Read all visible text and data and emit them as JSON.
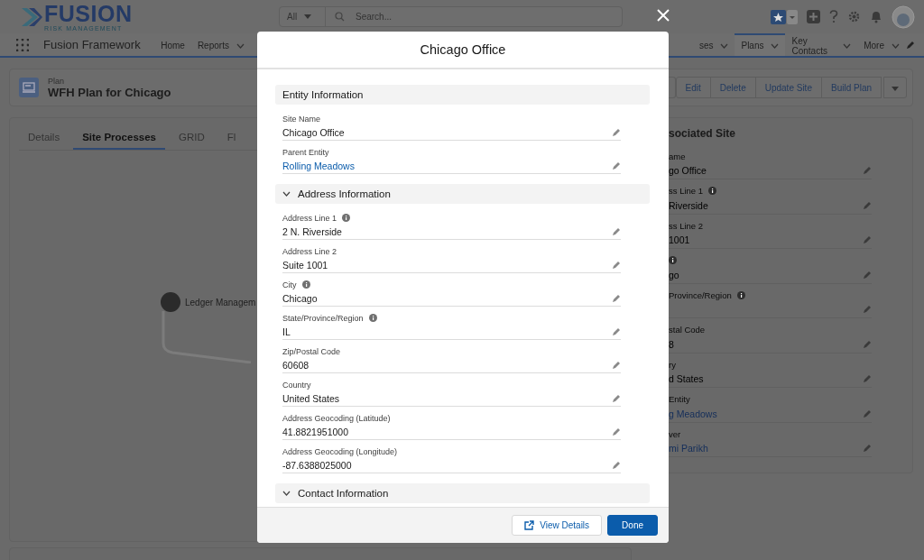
{
  "header": {
    "logo": {
      "name": "FUSION",
      "tagline": "RISK MANAGEMENT"
    },
    "search": {
      "scope": "All",
      "placeholder": "Search..."
    }
  },
  "nav": {
    "app_name": "Fusion Framework",
    "items_left": [
      {
        "label": "Home",
        "dropdown": false,
        "selected": false
      },
      {
        "label": "Reports",
        "dropdown": true,
        "selected": false
      }
    ],
    "items_right": [
      {
        "label": "ses",
        "dropdown": true,
        "selected": false
      },
      {
        "label": "Plans",
        "dropdown": true,
        "selected": true
      },
      {
        "label": "Key Contacts",
        "dropdown": true,
        "selected": false
      },
      {
        "label": "More",
        "dropdown": true,
        "selected": false
      }
    ]
  },
  "record": {
    "type": "Plan",
    "title": "WFH Plan for Chicago",
    "actions": [
      "Edit",
      "Delete",
      "Update Site",
      "Build Plan"
    ]
  },
  "tabs": [
    {
      "label": "Details",
      "selected": false
    },
    {
      "label": "Site Processes",
      "selected": true
    },
    {
      "label": "GRID",
      "selected": false
    },
    {
      "label": "Fl",
      "selected": false
    }
  ],
  "diagram": {
    "nodes": [
      {
        "label": "Ledger Managem"
      }
    ]
  },
  "side_panel": {
    "title": "sociated Site",
    "fields": [
      {
        "label": "ame",
        "value": "go Office",
        "info": false,
        "link": false
      },
      {
        "label": "ss Line 1",
        "value": "Riverside",
        "info": true,
        "link": false
      },
      {
        "label": "ss Line 2",
        "value": "1001",
        "info": false,
        "link": false
      },
      {
        "value": "go",
        "info": true,
        "link": false
      },
      {
        "label": "Province/Region",
        "info": true,
        "link": false
      },
      {
        "label": "stal Code",
        "value": "8",
        "info": false,
        "link": false
      },
      {
        "label": "ry",
        "value": "d States",
        "info": false,
        "link": false
      },
      {
        "label": "Entity",
        "value": "g Meadows",
        "info": false,
        "link": true
      },
      {
        "label": "ver",
        "value": "mi Parikh",
        "info": false,
        "link": true
      }
    ]
  },
  "modal": {
    "title": "Chicago Office",
    "sections": [
      {
        "title": "Entity Information",
        "kind": "plain",
        "fields": [
          {
            "label": "Site Name",
            "value": "Chicago Office",
            "info": false,
            "link": false
          },
          {
            "label": "Parent Entity",
            "value": "Rolling Meadows",
            "info": false,
            "link": true
          }
        ]
      },
      {
        "title": "Address Information",
        "kind": "collapsible",
        "expanded": true,
        "fields": [
          {
            "label": "Address Line 1",
            "value": "2 N. Riverside",
            "info": true,
            "link": false
          },
          {
            "label": "Address Line 2",
            "value": "Suite 1001",
            "info": false,
            "link": false
          },
          {
            "label": "City",
            "value": "Chicago",
            "info": true,
            "link": false
          },
          {
            "label": "State/Province/Region",
            "value": "IL",
            "info": true,
            "link": false
          },
          {
            "label": "Zip/Postal Code",
            "value": "60608",
            "info": false,
            "link": false
          },
          {
            "label": "Country",
            "value": "United States",
            "info": false,
            "link": false
          },
          {
            "label": "Address Geocoding (Latitude)",
            "value": "41.8821951000",
            "info": false,
            "link": false
          },
          {
            "label": "Address Geocoding (Longitude)",
            "value": "-87.6388025000",
            "info": false,
            "link": false
          }
        ]
      },
      {
        "title": "Contact Information",
        "kind": "collapsible",
        "expanded": true
      }
    ],
    "buttons": [
      {
        "label": "View Details",
        "kind": "neutral"
      },
      {
        "label": "Done",
        "kind": "brand"
      }
    ]
  }
}
